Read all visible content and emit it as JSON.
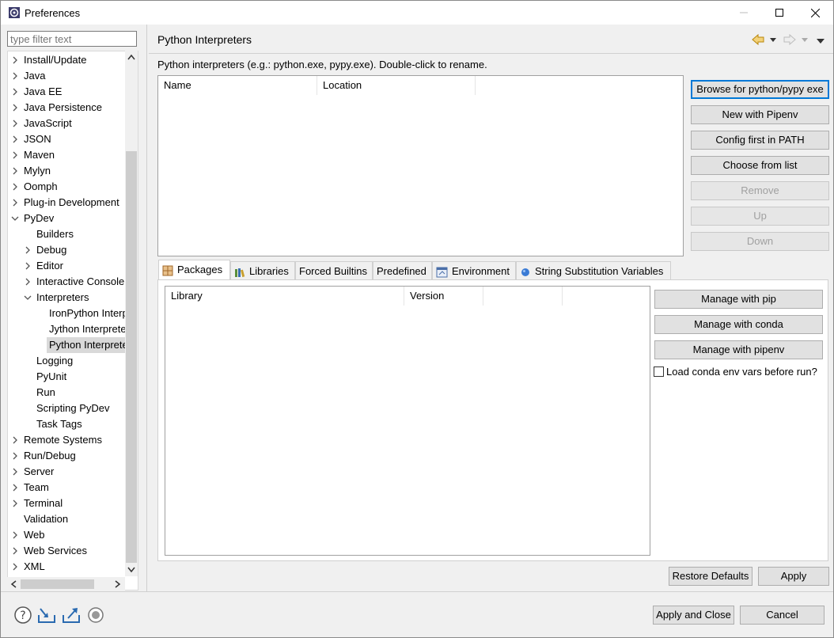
{
  "window": {
    "title": "Preferences",
    "icon": "eclipse-icon"
  },
  "filter": {
    "placeholder": "type filter text"
  },
  "tree": {
    "items": [
      {
        "label": "Install/Update",
        "expandable": true
      },
      {
        "label": "Java",
        "expandable": true
      },
      {
        "label": "Java EE",
        "expandable": true
      },
      {
        "label": "Java Persistence",
        "expandable": true
      },
      {
        "label": "JavaScript",
        "expandable": true
      },
      {
        "label": "JSON",
        "expandable": true
      },
      {
        "label": "Maven",
        "expandable": true
      },
      {
        "label": "Mylyn",
        "expandable": true
      },
      {
        "label": "Oomph",
        "expandable": true
      },
      {
        "label": "Plug-in Development",
        "expandable": true
      },
      {
        "label": "PyDev",
        "expandable": true,
        "expanded": true
      },
      {
        "label": "Builders"
      },
      {
        "label": "Debug",
        "expandable": true
      },
      {
        "label": "Editor",
        "expandable": true
      },
      {
        "label": "Interactive Console",
        "expandable": true
      },
      {
        "label": "Interpreters",
        "expandable": true,
        "expanded": true
      },
      {
        "label": "IronPython Interpreter"
      },
      {
        "label": "Jython Interpreter"
      },
      {
        "label": "Python Interpreter",
        "selected": true
      },
      {
        "label": "Logging"
      },
      {
        "label": "PyUnit"
      },
      {
        "label": "Run"
      },
      {
        "label": "Scripting PyDev"
      },
      {
        "label": "Task Tags"
      },
      {
        "label": "Remote Systems",
        "expandable": true
      },
      {
        "label": "Run/Debug",
        "expandable": true
      },
      {
        "label": "Server",
        "expandable": true
      },
      {
        "label": "Team",
        "expandable": true
      },
      {
        "label": "Terminal",
        "expandable": true
      },
      {
        "label": "Validation"
      },
      {
        "label": "Web",
        "expandable": true
      },
      {
        "label": "Web Services",
        "expandable": true
      },
      {
        "label": "XML",
        "expandable": true
      }
    ]
  },
  "page": {
    "title": "Python Interpreters",
    "description": "Python interpreters (e.g.: python.exe, pypy.exe).   Double-click to rename.",
    "interpreters_table": {
      "columns": [
        "Name",
        "Location"
      ]
    },
    "side_buttons": [
      {
        "label": "Browse for python/pypy exe",
        "enabled": true
      },
      {
        "label": "New with Pipenv",
        "enabled": true
      },
      {
        "label": "Config first in PATH",
        "enabled": true
      },
      {
        "label": "Choose from list",
        "enabled": true
      },
      {
        "label": "Remove",
        "enabled": false
      },
      {
        "label": "Up",
        "enabled": false
      },
      {
        "label": "Down",
        "enabled": false
      }
    ],
    "tabs": [
      {
        "label": "Packages",
        "icon": "package-icon",
        "active": true
      },
      {
        "label": "Libraries",
        "icon": "libraries-icon"
      },
      {
        "label": "Forced Builtins"
      },
      {
        "label": "Predefined"
      },
      {
        "label": "Environment",
        "icon": "environment-icon"
      },
      {
        "label": "String Substitution Variables",
        "icon": "variables-icon"
      }
    ],
    "packages_table": {
      "columns": [
        "Library",
        "Version"
      ]
    },
    "package_buttons": [
      "Manage with pip",
      "Manage with conda",
      "Manage with pipenv"
    ],
    "conda_checkbox": {
      "label": "Load conda env vars before run?",
      "checked": false
    },
    "restore_defaults": "Restore Defaults",
    "apply": "Apply"
  },
  "footer": {
    "apply_and_close": "Apply and Close",
    "cancel": "Cancel",
    "icons": [
      "help-icon",
      "import-icon",
      "export-icon",
      "record-icon"
    ]
  },
  "colors": {
    "focus": "#0078d7",
    "selection": "#d9d9d9",
    "nav_arrow": "#d4a017"
  }
}
